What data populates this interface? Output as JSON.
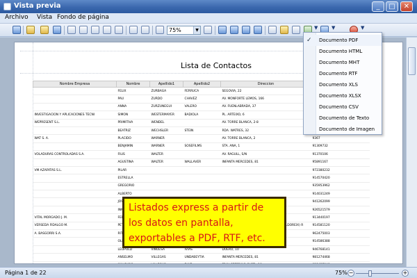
{
  "window": {
    "title": "Vista previa",
    "controls": [
      "minimize",
      "maximize",
      "close"
    ]
  },
  "menubar": {
    "items": [
      "Archivo",
      "Vista",
      "Fondo de página"
    ]
  },
  "toolbar": {
    "zoom_value": "75%",
    "icons": [
      "binoculars-icon",
      "find-icon",
      "open-icon",
      "save-icon",
      "page-setup-icon",
      "print-icon",
      "print-quick-icon",
      "margins-icon",
      "header-footer-icon",
      "scale-icon",
      "hand-icon",
      "magnifier-icon",
      "zoom-out-icon",
      "zoom-in-icon",
      "first-page-icon",
      "prev-page-icon",
      "next-page-icon",
      "last-page-icon",
      "multi-page-icon",
      "color-icon",
      "watermark-icon",
      "export-icon",
      "email-icon",
      "close-preview-icon"
    ]
  },
  "report": {
    "title": "Lista de Contactos",
    "columns": [
      "Nombre Empresa",
      "Nombre",
      "Apellido1",
      "Apellido2",
      "Direccion"
    ],
    "rows": [
      [
        "",
        "FELIX",
        "ZURBAGA",
        "FERRUCA",
        "SEGOVIA, 22",
        "9145"
      ],
      [
        "",
        "PAU",
        "ZURDO",
        "CHAVEZ",
        "AV. MONFORTE LEMOS, 166",
        "9637"
      ],
      [
        "",
        "ANNA",
        "ZURZUNEGUI",
        "VALERO",
        "AV. FUENLABRADA, 37",
        "9492"
      ],
      [
        "INVESTIGACION Y APLICACIONES TECNI",
        "SIMON",
        "WESTERMAYER",
        "BADIOLA",
        "PL. ARTEIXO, 6",
        "9284"
      ],
      [
        "WEPRESENT S.L.",
        "PRIMITIVA",
        "WENDEL",
        "",
        "AV. TORRE BLANCA, 2-8",
        "9135"
      ],
      [
        "",
        "BEATRIZ",
        "WECHSLER",
        "STEIN",
        "RDA. WATRES, 32",
        "9164"
      ],
      [
        "WAT S. A.",
        "PLACIDO",
        "WARNER",
        "",
        "AV. TORRE BLANCA, 2",
        "9367"
      ],
      [
        "",
        "BENJAMIN",
        "WARNER",
        "SOSEFILMS",
        "STA. ANA, 1",
        "91309732"
      ],
      [
        "VOLADURAS CONTROLADAS S.A.",
        "FILIS",
        "WALTER",
        "",
        "AV. RAGULL, S/N",
        "91370106"
      ],
      [
        "",
        "AGUSTINA",
        "WALTER",
        "WALLAVER",
        "INFANTA MERCEDES, 81",
        "95891167"
      ],
      [
        "VM AZAFATAS S.L.",
        "PILAR",
        "",
        "",
        "",
        "972380232"
      ],
      [
        "",
        "ESTRELLA",
        "",
        "",
        "",
        "914570420"
      ],
      [
        "",
        "GREGORIO",
        "",
        "",
        "",
        "935953962"
      ],
      [
        "",
        "ALBERTO",
        "",
        "",
        "",
        "914031249"
      ],
      [
        "",
        "JOSE-MARIA",
        "",
        "",
        "",
        "941262099"
      ],
      [
        "",
        "INMACULADA",
        "",
        "",
        "",
        "926521579"
      ],
      [
        "VITAL MORGADO J. M.",
        "FEDAD",
        "",
        "",
        "",
        "913440197"
      ],
      [
        "VERSEDA FIDALGO M.",
        "PETRA",
        "VERDASER",
        "",
        "AV. MOSSEN JACINT VERDAGUER, 57 (VALLDOREIX) R",
        "914581120"
      ],
      [
        "A. BASGORRI S.A.",
        "RITA",
        "VIRGOS",
        "CANTALAPIEDRA",
        "MAR MENOR, 38",
        "962475003"
      ],
      [
        "",
        "OLIVER",
        "VINUESA",
        "CORTAZAR",
        "JORGE JUAN, 70",
        "914586388"
      ],
      [
        "",
        "LEOPOLD",
        "VINUESA",
        "IVIAS",
        "DUERO, 10",
        "946768141"
      ],
      [
        "",
        "ANSELMO",
        "VILLEGAS",
        "UNDABEYTIA",
        "INFANTA MERCEDES, 81",
        "981274468"
      ],
      [
        "",
        "MAURICIO",
        "VILLEGAS",
        "DIAZ",
        "FRAY CEFERINO GLEZ., 16",
        "915457948"
      ],
      [
        "",
        "QUERALT",
        "VILLEGAS",
        "CASTILLO",
        "FRANCIA, 8 (POZUELO)",
        "914596848"
      ]
    ]
  },
  "callout": {
    "lines": [
      "Listados express a partir de",
      "los datos en pantalla,",
      "exportables a PDF, RTF, etc."
    ]
  },
  "export_menu": {
    "items": [
      {
        "label": "Documento PDF",
        "checked": true
      },
      {
        "label": "Documento HTML",
        "checked": false
      },
      {
        "label": "Documento MHT",
        "checked": false
      },
      {
        "label": "Documento RTF",
        "checked": false
      },
      {
        "label": "Documento XLS",
        "checked": false
      },
      {
        "label": "Documento XLSX",
        "checked": false
      },
      {
        "label": "Documento CSV",
        "checked": false
      },
      {
        "label": "Documento de Texto",
        "checked": false
      },
      {
        "label": "Documento de Imagen",
        "checked": false
      }
    ]
  },
  "statusbar": {
    "page_info": "Página 1 de 22",
    "zoom": "75%"
  },
  "colors": {
    "callout_background": "#ffff00",
    "callout_text": "#d71616",
    "titlebar": "#3b68ae"
  }
}
